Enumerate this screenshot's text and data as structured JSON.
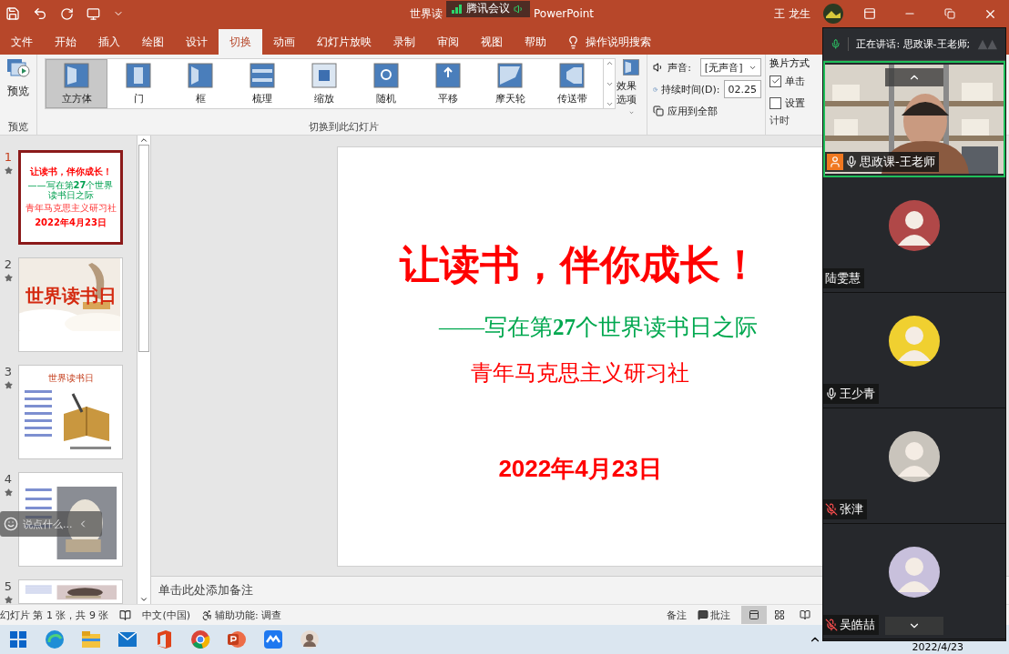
{
  "title_bar": {
    "title_left": "世界读",
    "title_right": "PowerPoint",
    "meeting_badge": "腾讯会议",
    "user": "王 龙生"
  },
  "tabs": [
    {
      "label": "文件",
      "selected": false
    },
    {
      "label": "开始",
      "selected": false
    },
    {
      "label": "插入",
      "selected": false
    },
    {
      "label": "绘图",
      "selected": false
    },
    {
      "label": "设计",
      "selected": false
    },
    {
      "label": "切换",
      "selected": true
    },
    {
      "label": "动画",
      "selected": false
    },
    {
      "label": "幻灯片放映",
      "selected": false
    },
    {
      "label": "录制",
      "selected": false
    },
    {
      "label": "审阅",
      "selected": false
    },
    {
      "label": "视图",
      "selected": false
    },
    {
      "label": "帮助",
      "selected": false
    }
  ],
  "tell_me": "操作说明搜索",
  "ribbon": {
    "preview": "预览",
    "preview_group": "预览",
    "transitions": [
      {
        "label": "立方体",
        "selected": true
      },
      {
        "label": "门",
        "selected": false
      },
      {
        "label": "框",
        "selected": false
      },
      {
        "label": "梳理",
        "selected": false
      },
      {
        "label": "缩放",
        "selected": false
      },
      {
        "label": "随机",
        "selected": false
      },
      {
        "label": "平移",
        "selected": false
      },
      {
        "label": "摩天轮",
        "selected": false
      },
      {
        "label": "传送带",
        "selected": false
      }
    ],
    "gallery_group": "切换到此幻灯片",
    "effect_options": "效果选项",
    "sound_label": "声音:",
    "sound_value": "[无声音]",
    "duration_label": "持续时间(D):",
    "duration_value": "02.25",
    "apply_all": "应用到全部",
    "advance_title": "换片方式",
    "advance": [
      {
        "label": "单击",
        "checked": true
      },
      {
        "label": "设置",
        "checked": false
      }
    ],
    "timing_group": "计时"
  },
  "thumbnails": [
    {
      "number": "1",
      "selected": true,
      "kind": "title",
      "title": "让读书，伴你成长！",
      "subtitle": "——写在第**27**个世界读书日之际",
      "organization": "青年马克思主义研习社",
      "date": "2022年4月23日"
    },
    {
      "number": "2",
      "selected": false,
      "kind": "banner",
      "title": "世界读书日"
    },
    {
      "number": "3",
      "selected": false,
      "kind": "article",
      "title": "世界读书日"
    },
    {
      "number": "4",
      "selected": false
    },
    {
      "number": "5",
      "selected": false
    }
  ],
  "chat_box": {
    "placeholder": "说点什么..."
  },
  "slide": {
    "title": "让读书，伴你成长！",
    "subtitle": "——写在第**27**个世界读书日之际",
    "organization": "青年马克思主义研习社",
    "date": "2022年4月23日"
  },
  "notes": {
    "placeholder": "单击此处添加备注"
  },
  "status_bar": {
    "slide_info": "幻灯片 第 1 张，共 9 张",
    "language": "中文(中国)",
    "accessibility": "辅助功能: 调查",
    "notes": "备注",
    "comments": "批注",
    "views": [
      {
        "kind": "normal",
        "selected": true
      },
      {
        "kind": "sorter",
        "selected": false
      },
      {
        "kind": "reading",
        "selected": false
      }
    ]
  },
  "meeting": {
    "speaking": "正在讲话: 思政课-王老师;",
    "participants": [
      {
        "name": "思政课-王老师",
        "kind": "video",
        "muted": false
      },
      {
        "name": "陆雯慧",
        "kind": "avatar"
      },
      {
        "name": "王少青",
        "kind": "avatar",
        "muted": false
      },
      {
        "name": "张津",
        "kind": "avatar",
        "muted": true
      },
      {
        "name": "吴皓喆",
        "kind": "avatar",
        "muted": true
      }
    ]
  },
  "taskbar": {
    "apps": [
      {
        "kind": "windows"
      },
      {
        "kind": "edge"
      },
      {
        "kind": "files"
      },
      {
        "kind": "mail"
      },
      {
        "kind": "office"
      },
      {
        "kind": "chrome"
      },
      {
        "kind": "powerpoint"
      },
      {
        "kind": "meeting"
      },
      {
        "kind": "avatar"
      }
    ],
    "date": "2022/4/23"
  }
}
